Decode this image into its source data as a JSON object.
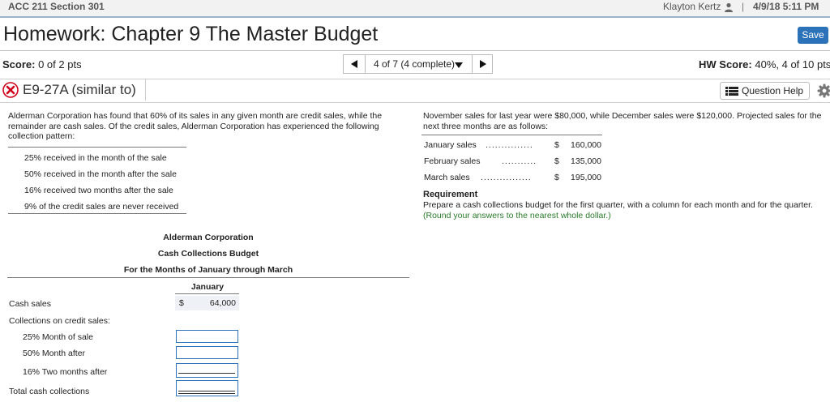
{
  "header": {
    "course": "ACC 211 Section 301",
    "user": "Klayton Kertz",
    "separator": "|",
    "datetime": "4/9/18 5:11 PM"
  },
  "page": {
    "title": "Homework: Chapter 9 The Master Budget",
    "save_label": "Save"
  },
  "status": {
    "score_label": "Score:",
    "score_value": "0 of 2 pts",
    "nav_text": "4 of 7 (4 complete)",
    "hw_label": "HW Score:",
    "hw_value": "40%, 4 of 10 pts"
  },
  "question": {
    "id": "E9-27A (similar to)",
    "help_label": "Question Help"
  },
  "problem": {
    "intro": "Alderman Corporation has found that 60% of its sales in any given month are credit sales, while the remainder are cash sales. Of the credit sales, Alderman Corporation has experienced the following collection pattern:",
    "patterns": [
      "25% received in the month of the sale",
      "50% received in the month after the sale",
      "16% received two months after the sale",
      "9% of the credit sales are never received"
    ],
    "sales_intro": "November sales for last year were $80,000, while December sales were $120,000. Projected sales for the next three months are as follows:",
    "projections": [
      {
        "label": "January sales",
        "dots": "...............",
        "dollar": "$",
        "amount": "160,000"
      },
      {
        "label": "February sales",
        "dots": "...........",
        "dollar": "$",
        "amount": "135,000"
      },
      {
        "label": "March sales",
        "dots": "................",
        "dollar": "$",
        "amount": "195,000"
      }
    ],
    "requirement_title": "Requirement",
    "requirement_text": "Prepare a cash collections budget for the first quarter, with a column for each month and for the quarter.",
    "requirement_note": "(Round your answers to the nearest whole dollar.)"
  },
  "budget": {
    "company": "Alderman Corporation",
    "name": "Cash Collections Budget",
    "period": "For the Months of January through March",
    "month": "January",
    "rows": {
      "cash_sales": "Cash sales",
      "collections": "Collections on credit sales:",
      "month_of_sale": "25% Month of sale",
      "month_after": "50% Month after",
      "two_months_after": "16% Two months after",
      "total": "Total cash collections"
    },
    "cash_sales_dollar": "$",
    "cash_sales_value": "64,000",
    "inputs": {
      "month_of_sale": "",
      "month_after": "",
      "two_months_after": "",
      "total": ""
    }
  }
}
